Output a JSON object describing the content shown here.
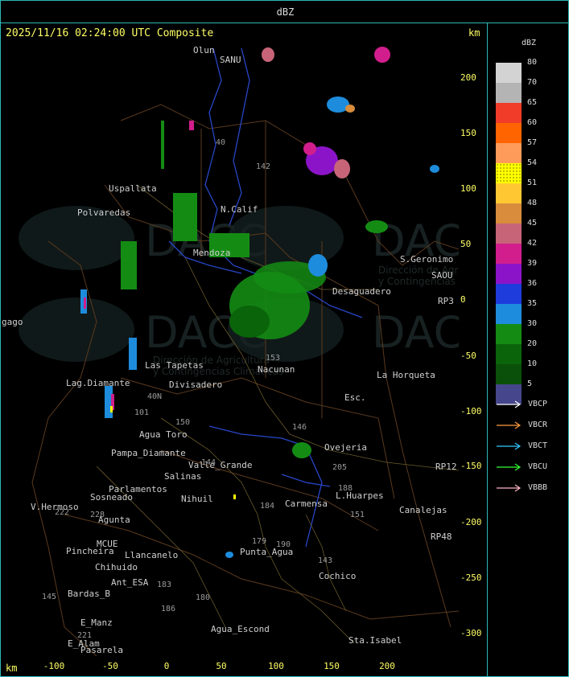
{
  "header": {
    "product": "dBZ"
  },
  "info": {
    "timestamp": "2025/11/16 02:24:00 UTC Composite",
    "unit_top": "km",
    "unit_bottom": "km"
  },
  "axes": {
    "x_ticks": [
      "-100",
      "-50",
      "0",
      "50",
      "100",
      "150",
      "200"
    ],
    "y_ticks": [
      "200",
      "150",
      "100",
      "50",
      "0",
      "-50",
      "-100",
      "-150",
      "-200",
      "-250",
      "-300"
    ]
  },
  "legend": {
    "title": "dBZ",
    "scale": [
      {
        "label": "80",
        "color": "#d3d3d3"
      },
      {
        "label": "70",
        "color": "#b4b4b4"
      },
      {
        "label": "65",
        "color": "#f03c28"
      },
      {
        "label": "60",
        "color": "#ff6400"
      },
      {
        "label": "57",
        "color": "#ff9b5a"
      },
      {
        "label": "54",
        "color": "#ffff00"
      },
      {
        "label": "51",
        "color": "#ffc832"
      },
      {
        "label": "48",
        "color": "#d88c3c"
      },
      {
        "label": "45",
        "color": "#c86478"
      },
      {
        "label": "42",
        "color": "#d21e8c"
      },
      {
        "label": "39",
        "color": "#8c14c8"
      },
      {
        "label": "36",
        "color": "#1e3cdc"
      },
      {
        "label": "35",
        "color": "#1e8cdc"
      },
      {
        "label": "30",
        "color": "#148c14"
      },
      {
        "label": "20",
        "color": "#0a640a"
      },
      {
        "label": "10",
        "color": "#0a500a"
      },
      {
        "label": "5",
        "color": "#46468c"
      }
    ],
    "radars": [
      {
        "name": "VBCP",
        "color": "#ffffff"
      },
      {
        "name": "VBCR",
        "color": "#ff9b3c"
      },
      {
        "name": "VBCT",
        "color": "#32c8ff"
      },
      {
        "name": "VBCU",
        "color": "#32ff32"
      },
      {
        "name": "VBBB",
        "color": "#ffb4c8"
      }
    ]
  },
  "watermark": {
    "brand": "DACC",
    "line1": "Dirección de Agricultura",
    "line2": "y Contingencias Climáticas"
  },
  "places": [
    {
      "name": "Olun"
    },
    {
      "name": "SANU"
    },
    {
      "name": "Uspallata"
    },
    {
      "name": "Polvaredas"
    },
    {
      "name": "N.Calif"
    },
    {
      "name": "Mendoza"
    },
    {
      "name": "Desaguadero"
    },
    {
      "name": "S.Geronimo"
    },
    {
      "name": "SAOU"
    },
    {
      "name": "Nacunan"
    },
    {
      "name": "La Horqueta"
    },
    {
      "name": "Esc."
    },
    {
      "name": "Las Tapetas"
    },
    {
      "name": "Divisadero"
    },
    {
      "name": "Lag.Diamante"
    },
    {
      "name": "Agua Toro"
    },
    {
      "name": "Pampa_Diamante"
    },
    {
      "name": "Valle_Grande"
    },
    {
      "name": "Salinas"
    },
    {
      "name": "Nihuil"
    },
    {
      "name": "Parlamentos"
    },
    {
      "name": "Sosneado"
    },
    {
      "name": "V.Hermoso"
    },
    {
      "name": "Agunta"
    },
    {
      "name": "Ovejeria"
    },
    {
      "name": "L.Huarpes"
    },
    {
      "name": "Canalejas"
    },
    {
      "name": "Carmensa"
    },
    {
      "name": "Punta_Agua"
    },
    {
      "name": "Pincheira"
    },
    {
      "name": "Llancanelo"
    },
    {
      "name": "Chihuido"
    },
    {
      "name": "Ant_ESA"
    },
    {
      "name": "Bardas_B"
    },
    {
      "name": "E_Manz"
    },
    {
      "name": "E_Alam"
    },
    {
      "name": "Pasarela"
    },
    {
      "name": "Agua_Escond"
    },
    {
      "name": "Cochico"
    },
    {
      "name": "Sta.Isabel"
    },
    {
      "name": "MCUE"
    },
    {
      "name": "RP3"
    },
    {
      "name": "RP12"
    },
    {
      "name": "RP48"
    },
    {
      "name": "gago"
    }
  ],
  "routes": [
    "40",
    "142",
    "146",
    "153",
    "150",
    "144",
    "143",
    "184",
    "180",
    "186",
    "183",
    "179",
    "190",
    "188",
    "151",
    "205",
    "101",
    "40N",
    "221",
    "145",
    "222",
    "228"
  ]
}
